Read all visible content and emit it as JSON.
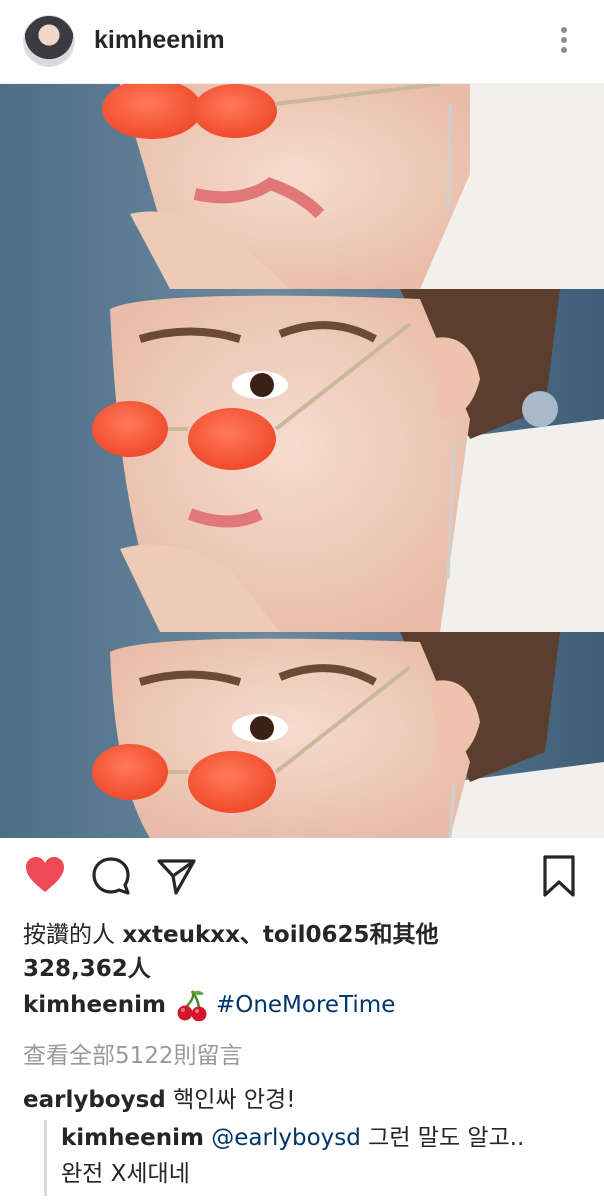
{
  "post": {
    "username": "kimheenim",
    "likes_prefix": "按讚的人 ",
    "liker1": "xxteukxx",
    "sep": "、",
    "liker2": "toil0625",
    "likes_suffix": "和其他",
    "likes_count": "328,362人",
    "caption_hashtag": "#OneMoreTime",
    "view_all_comments": "查看全部5122則留言",
    "comment": {
      "username": "earlyboysd",
      "text": "핵인싸 안경!"
    },
    "reply": {
      "username": "kimheenim",
      "mention": "@earlyboysd",
      "text_line1": " 그런 말도 알고..",
      "text_line2": "완전 X세대네"
    }
  },
  "icons": [
    "more-vertical-icon",
    "heart-icon",
    "comment-icon",
    "share-icon",
    "bookmark-icon",
    "cherry-emoji"
  ],
  "colors": {
    "heart": "#ed4956",
    "link": "#003569",
    "muted": "#999999",
    "text": "#262626"
  }
}
